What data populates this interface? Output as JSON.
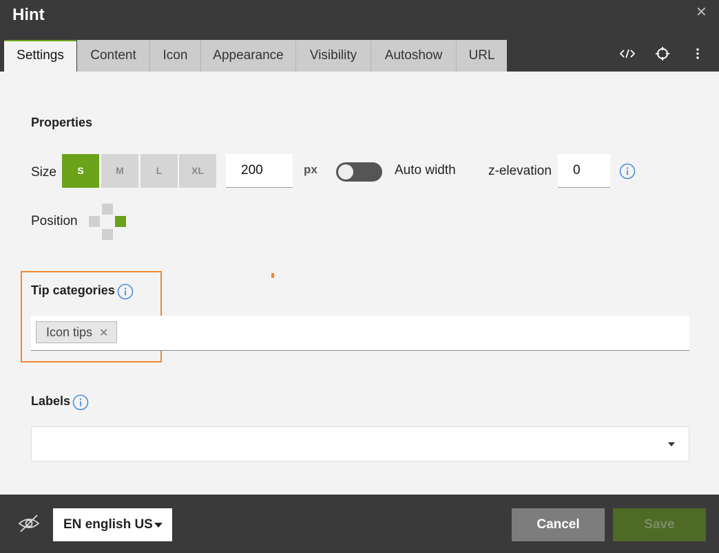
{
  "dialog": {
    "title": "Hint"
  },
  "tabs": [
    {
      "label": "Settings"
    },
    {
      "label": "Content"
    },
    {
      "label": "Icon"
    },
    {
      "label": "Appearance"
    },
    {
      "label": "Visibility"
    },
    {
      "label": "Autoshow"
    },
    {
      "label": "URL"
    }
  ],
  "header_icons": [
    "code-icon",
    "crosshair-icon",
    "more-vertical-icon"
  ],
  "properties": {
    "title": "Properties",
    "size_label": "Size",
    "size_options": [
      "S",
      "M",
      "L",
      "XL"
    ],
    "size_selected": "S",
    "width_value": "200",
    "width_unit": "px",
    "auto_width_label": "Auto width",
    "auto_width_on": false,
    "z_elevation_label": "z-elevation",
    "z_elevation_value": "0",
    "position_label": "Position",
    "position_selected": "right"
  },
  "tip_categories": {
    "title": "Tip categories",
    "tags": [
      "Icon tips"
    ]
  },
  "labels": {
    "title": "Labels",
    "value": ""
  },
  "footer": {
    "language": "EN english US",
    "cancel_label": "Cancel",
    "save_label": "Save"
  },
  "colors": {
    "accent": "#6aa21a",
    "dark_bg": "#3a3a3a",
    "highlight": "#f0882e",
    "info": "#4a8fd8"
  }
}
